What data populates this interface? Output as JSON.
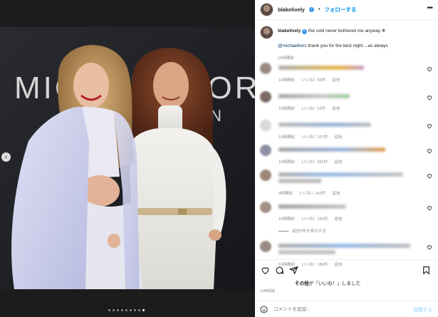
{
  "post": {
    "username": "blakelively",
    "follow_label": "フォローする",
    "more_label": "•••",
    "caption": "the cold never bothered me anyway ❄",
    "caption_mention": "@michaelkors",
    "caption_line2": "thank you for the best night ...as always",
    "caption_time": "10時間前"
  },
  "photo": {
    "backdrop_text": "MICHAEL KORS",
    "sub_text": "ON",
    "prev_arrow": "‹"
  },
  "comments": [
    {
      "time": "10時間前",
      "likes": "いいね！56件",
      "reply": "返信"
    },
    {
      "time": "10時間前",
      "likes": "いいね！52件",
      "reply": "返信"
    },
    {
      "time": "10時間前",
      "likes": "いいね！107件",
      "reply": "返信"
    },
    {
      "time": "10時間前",
      "likes": "いいね！255件",
      "reply": "返信"
    },
    {
      "time": "9時間前",
      "likes": "いいね！242件",
      "reply": "返信"
    },
    {
      "time": "10時間前",
      "likes": "いいね！192件",
      "reply": "返信"
    },
    {
      "time": "10時間前",
      "likes": "いいね！189件",
      "reply": "返信"
    }
  ],
  "replies_label": "返信2件を表示する",
  "likes_line": {
    "prefix": "その他",
    "suffix": "が「いいね！」しました"
  },
  "post_time": "10時間前",
  "comment_box": {
    "placeholder": "コメントを追加...",
    "post_label": "投稿する"
  },
  "icons": [
    "verified-icon",
    "heart-icon",
    "comment-icon",
    "share-icon",
    "bookmark-icon",
    "emoji-icon"
  ],
  "colors": {
    "accent": "#0095f6",
    "text": "#262626",
    "muted": "#8e8e8e"
  }
}
